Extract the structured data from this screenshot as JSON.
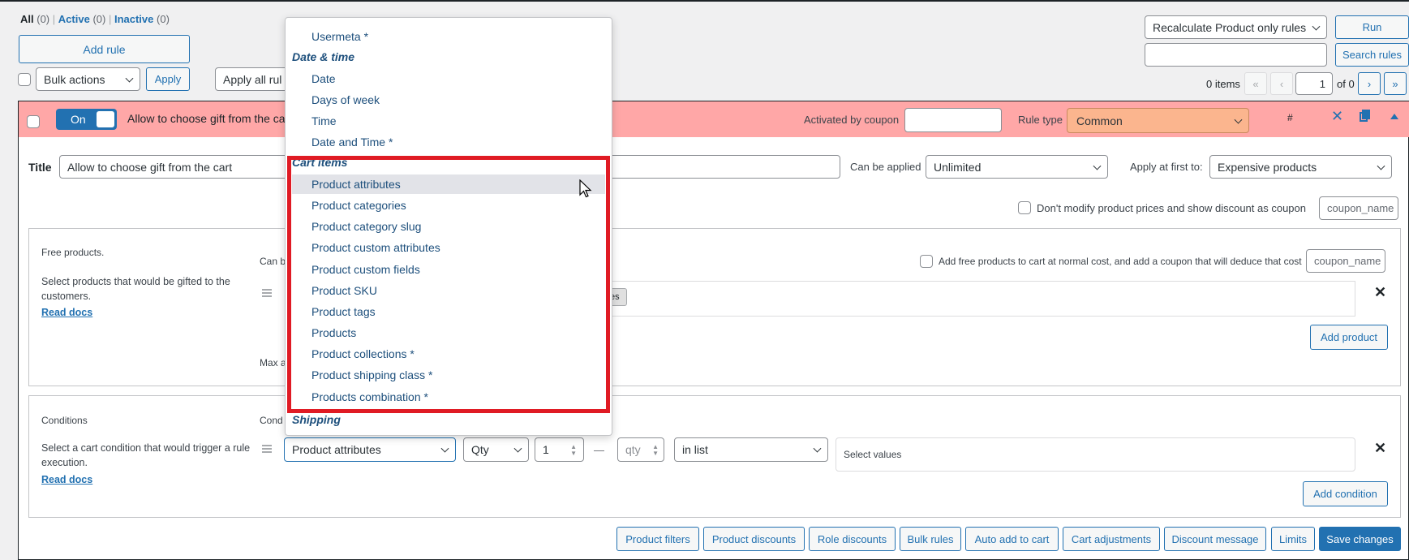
{
  "filters": {
    "all_label": "All",
    "all_count": "(0)",
    "active_label": "Active",
    "active_count": "(0)",
    "inactive_label": "Inactive",
    "inactive_count": "(0)",
    "sep": "|"
  },
  "toolbar": {
    "add_rule": "Add rule",
    "bulk_actions": "Bulk actions",
    "apply": "Apply",
    "apply_all_rules": "Apply all rul",
    "recalculate_select": "Recalculate Product only rules",
    "run": "Run",
    "search_value": "",
    "search_rules": "Search rules",
    "items_count": "0 items",
    "first_page": "«",
    "prev_page": "‹",
    "current_page": "1",
    "of_pages": "of 0",
    "next_page": "›",
    "last_page": "»"
  },
  "rule": {
    "toggle_label": "On",
    "name": "Allow to choose gift from the ca",
    "activated_by_coupon_label": "Activated by coupon",
    "activated_by_coupon_value": "",
    "rule_type_label": "Rule type",
    "rule_type_value": "Common",
    "hash": "#",
    "close": "✕",
    "title_label": "Title",
    "title_value": "Allow to choose gift from the cart",
    "can_be_applied_label": "Can be applied",
    "can_be_applied_value": "Unlimited",
    "apply_first_label": "Apply at first to:",
    "apply_first_value": "Expensive products",
    "dont_modify_label": "Don't modify product prices and show discount as coupon",
    "coupon_placeholder_1": "coupon_name"
  },
  "free_products": {
    "heading": "Free products.",
    "description": "Select products that would be gifted to the customers.",
    "read_docs": "Read docs",
    "can_be_label": "Can b",
    "add_free_label": "Add free products to cart at normal cost, and add a coupon that will deduce that cost",
    "coupon_placeholder_2": "coupon_name",
    "tag_partial": "es",
    "add_product": "Add product",
    "max_label": "Max a"
  },
  "conditions": {
    "heading": "Conditions",
    "description": "Select a cart condition that would trigger a rule execution.",
    "read_docs": "Read docs",
    "cond_label": "Cond",
    "type_value": "Product attributes",
    "qty_select": "Qty",
    "qty_from": "1",
    "dash": "—",
    "qty_to_placeholder": "qty",
    "in_list": "in list",
    "select_values_placeholder": "Select values",
    "add_condition": "Add condition"
  },
  "bottom_buttons": [
    "Product filters",
    "Product discounts",
    "Role discounts",
    "Bulk rules",
    "Auto add to cart",
    "Cart adjustments",
    "Discount message",
    "Limits",
    "Save changes"
  ],
  "dropdown": {
    "items_top": [
      "Usermeta *"
    ],
    "group_datetime": "Date & time",
    "datetime_items": [
      "Date",
      "Days of week",
      "Time",
      "Date and Time *"
    ],
    "group_cart": "Cart items",
    "cart_items": [
      "Product attributes",
      "Product categories",
      "Product category slug",
      "Product custom attributes",
      "Product custom fields",
      "Product SKU",
      "Product tags",
      "Products",
      "Product collections *",
      "Product shipping class *",
      "Products combination *"
    ],
    "group_shipping": "Shipping"
  },
  "colors": {
    "accent": "#2271b1",
    "rule_bar": "#ffa7a7",
    "rule_type_bg": "#fbb58e",
    "highlight": "#e01b24"
  }
}
